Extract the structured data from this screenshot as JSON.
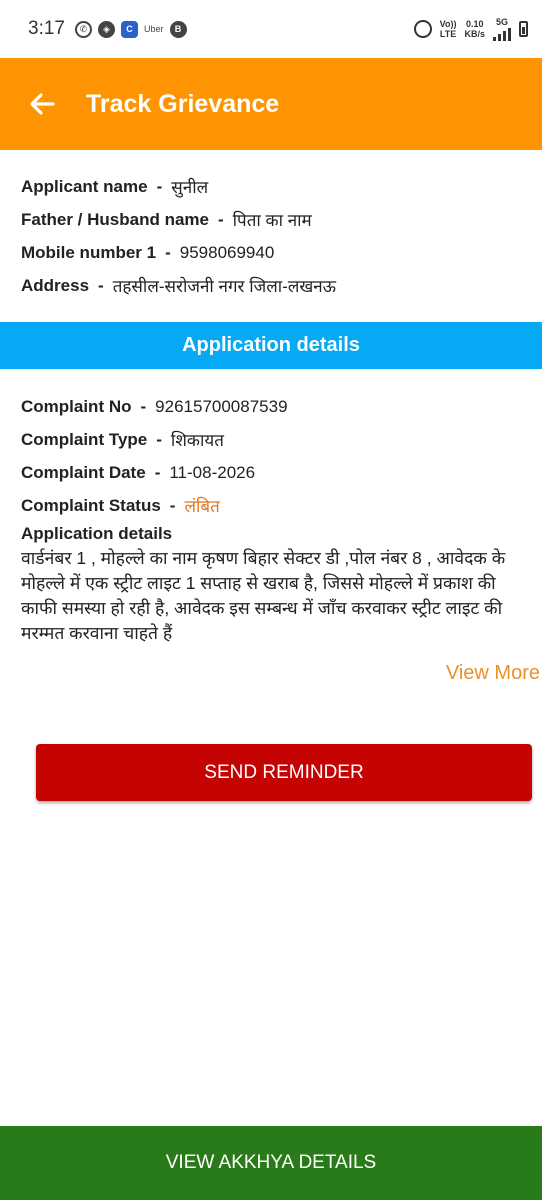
{
  "status_bar": {
    "time": "3:17",
    "uber_label": "Uber",
    "volte_top": "Vo))",
    "volte_bottom": "LTE",
    "speed_top": "0.10",
    "speed_bottom": "KB/s",
    "network": "5G",
    "icons": [
      "whatsapp-icon",
      "compass-icon",
      "c-app-icon",
      "uber-icon",
      "whatsapp-business-icon",
      "alarm-icon",
      "signal-icon",
      "battery-icon"
    ]
  },
  "header": {
    "title": "Track Grievance",
    "background": "#fe9402"
  },
  "applicant": {
    "name_label": "Applicant name",
    "name_value": "सुनील",
    "father_label": "Father / Husband name",
    "father_value": "पिता का नाम",
    "mobile_label": "Mobile number 1",
    "mobile_value": "9598069940",
    "address_label": "Address",
    "address_value": "तहसील-सरोजनी नगर जिला-लखनऊ",
    "separator": "-"
  },
  "section": {
    "title": "Application details",
    "background": "#06a9f4"
  },
  "complaint": {
    "no_label": "Complaint No",
    "no_value": "92615700087539",
    "type_label": "Complaint Type",
    "type_value": "शिकायत",
    "date_label": "Complaint Date",
    "date_value": "11-08-2026",
    "status_label": "Complaint Status",
    "status_value": "लंबित",
    "status_color": "#e1751e",
    "details_label": "Application details",
    "details_text": "वार्डनंबर 1 , मोहल्ले का नाम कृषण बिहार सेक्टर डी  ,पोल नंबर 8 , आवेदक के मोहल्ले में एक स्ट्रीट लाइट 1 सप्ताह  से खराब है, जिससे मोहल्ले में प्रकाश की काफी समस्या हो रही है, आवेदक इस सम्बन्ध में जाँच करवाकर स्ट्रीट लाइट की मरम्मत करवाना चाहते हैं"
  },
  "actions": {
    "view_more": "View More",
    "send_reminder": "SEND REMINDER",
    "send_reminder_color": "#c50303",
    "view_akkhya": "VIEW AKKHYA DETAILS",
    "view_akkhya_color": "#297a18"
  }
}
